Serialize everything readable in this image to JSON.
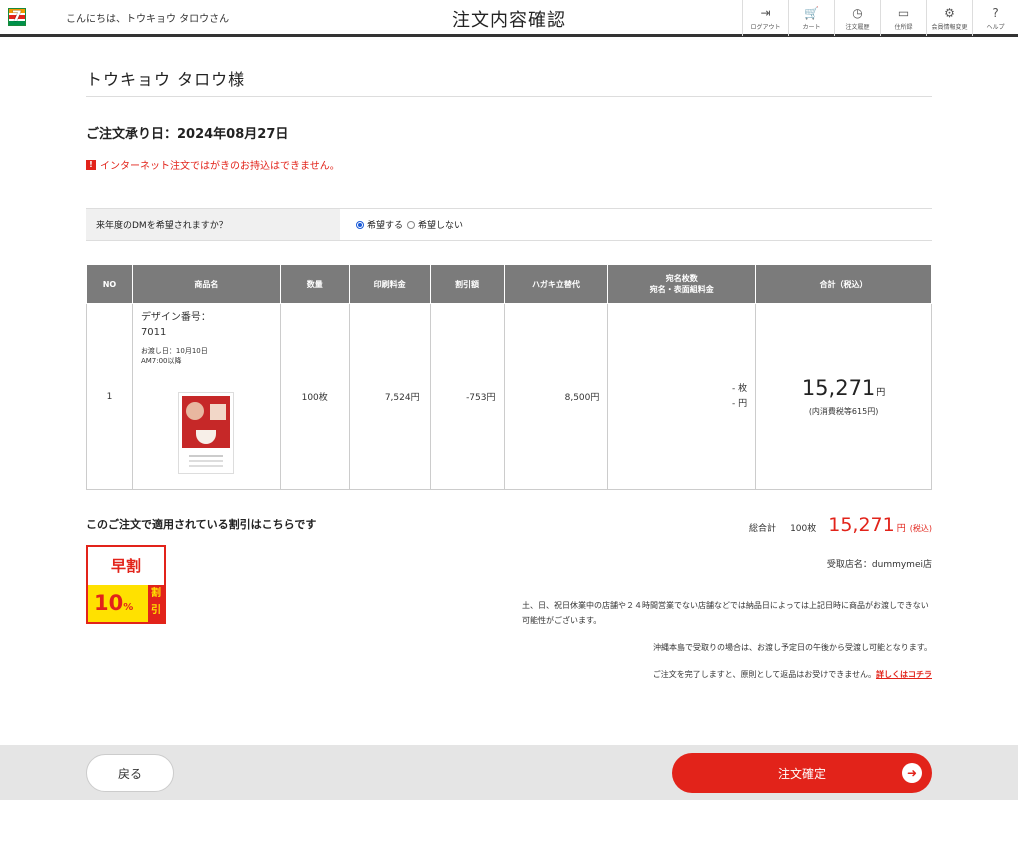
{
  "header": {
    "greeting": "こんにちは、トウキョウ タロウさん",
    "title": "注文内容確認",
    "icons": [
      {
        "name": "logout-icon",
        "glyph": "⇥",
        "label": "ログアウト"
      },
      {
        "name": "cart-icon",
        "glyph": "🛒",
        "label": "カート"
      },
      {
        "name": "history-icon",
        "glyph": "◷",
        "label": "注文履歴"
      },
      {
        "name": "address-book-icon",
        "glyph": "▭",
        "label": "住所録"
      },
      {
        "name": "settings-icon",
        "glyph": "⚙",
        "label": "会員情報変更"
      },
      {
        "name": "help-icon",
        "glyph": "?",
        "label": "ヘルプ"
      }
    ]
  },
  "customer_name": "トウキョウ タロウ様",
  "order_date": "ご注文承り日：2024年08月27日",
  "warning": "インターネット注文ではがきのお持込はできません。",
  "dm": {
    "question": "来年度のDMを希望されますか？",
    "option_yes": "希望する",
    "option_no": "希望しない",
    "selected": "希望する"
  },
  "table": {
    "headers": {
      "no": "NO",
      "product": "商品名",
      "qty": "数量",
      "print_fee": "印刷料金",
      "discount": "割引額",
      "postcard": "ハガキ立替代",
      "address_line1": "宛名枚数",
      "address_line2": "宛名・表面組料金",
      "total": "合計（税込）"
    },
    "rows": [
      {
        "no": "1",
        "design_label": "デザイン番号：",
        "design_no": "7011",
        "delivery_line1": "お渡し日：10月10日",
        "delivery_line2": "AM7:00以降",
        "qty": "100枚",
        "print_fee": "7,524円",
        "discount": "-753円",
        "postcard": "8,500円",
        "address_count": "- 枚",
        "address_fee": "- 円",
        "total": "15,271",
        "total_yen": "円",
        "total_tax": "(内消費税等615円)"
      }
    ]
  },
  "discount_section": {
    "title": "このご注文で適用されている割引はこちらです",
    "badge_top": "早割",
    "badge_pct": "10",
    "badge_pct_unit": "%",
    "badge_side": "割引"
  },
  "summary": {
    "label": "総合計",
    "qty": "100枚",
    "amount": "15,271",
    "yen": "円",
    "tax_note": "(税込)",
    "store": "受取店名：dummymei店"
  },
  "notes": {
    "line1": "土、日、祝日休業中の店舗や２４時間営業でない店舗などでは納品日によっては上記日時に商品がお渡しできない可能性がございます。",
    "line2": "沖縄本島で受取りの場合は、お渡し予定日の午後から受渡し可能となります。",
    "line3": "ご注文を完了しますと、原則として返品はお受けできません。",
    "link": "詳しくはコチラ"
  },
  "footer": {
    "back": "戻る",
    "confirm": "注文確定"
  },
  "colors": {
    "accent": "#e2231a",
    "header_gray": "#7b7b7b",
    "badge_yellow": "#ffe100"
  }
}
